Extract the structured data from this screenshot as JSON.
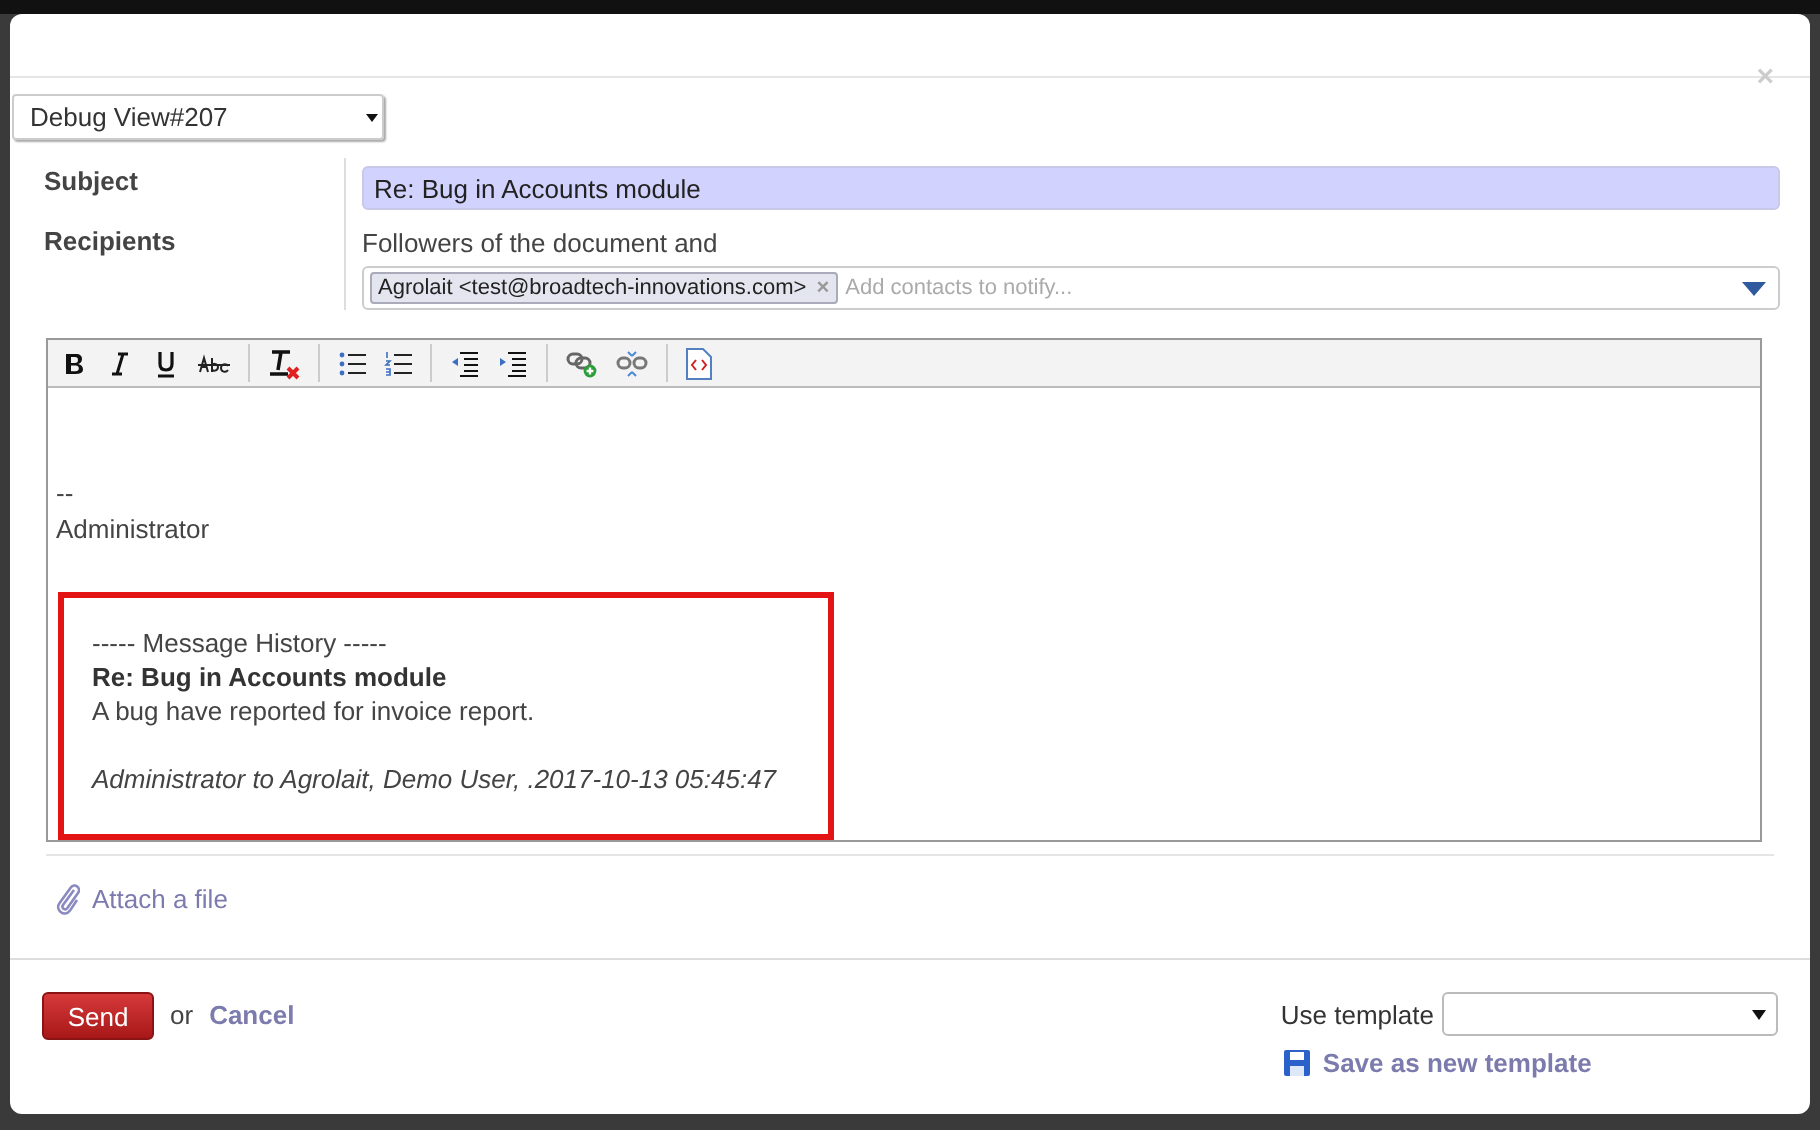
{
  "dialog": {
    "close": "×"
  },
  "view_select": {
    "value": "Debug View#207"
  },
  "form": {
    "subject_label": "Subject",
    "subject": "Re: Bug in Accounts module",
    "recipients_label": "Recipients",
    "recipients_note": "Followers of the document and",
    "recipient_tags": [
      {
        "label": "Agrolait <test@broadtech-innovations.com>",
        "remove": "×"
      }
    ],
    "recipients_placeholder": "Add contacts to notify..."
  },
  "editor": {
    "toolbar_groups": [
      {
        "buttons": [
          {
            "kind": "bold"
          },
          {
            "kind": "italic"
          },
          {
            "kind": "underline"
          },
          {
            "kind": "strike"
          }
        ]
      },
      {
        "buttons": [
          {
            "kind": "clear-format"
          }
        ]
      },
      {
        "buttons": [
          {
            "kind": "bullet-list"
          },
          {
            "kind": "number-list"
          }
        ]
      },
      {
        "buttons": [
          {
            "kind": "outdent"
          },
          {
            "kind": "indent"
          }
        ]
      },
      {
        "buttons": [
          {
            "kind": "link"
          },
          {
            "kind": "unlink"
          }
        ]
      },
      {
        "buttons": [
          {
            "kind": "source"
          }
        ]
      }
    ],
    "body_lines": [
      "--",
      "Administrator"
    ],
    "history": {
      "heading": "----- Message History -----",
      "title": "Re: Bug in Accounts module",
      "body": "A bug have reported for invoice report.",
      "signature": "Administrator to Agrolait, Demo User, .2017-10-13 05:45:47"
    }
  },
  "attach": "Attach a file",
  "footer": {
    "send": "Send",
    "or": "or",
    "cancel": "Cancel",
    "template_label": "Use template",
    "save_template": "Save as new template"
  }
}
